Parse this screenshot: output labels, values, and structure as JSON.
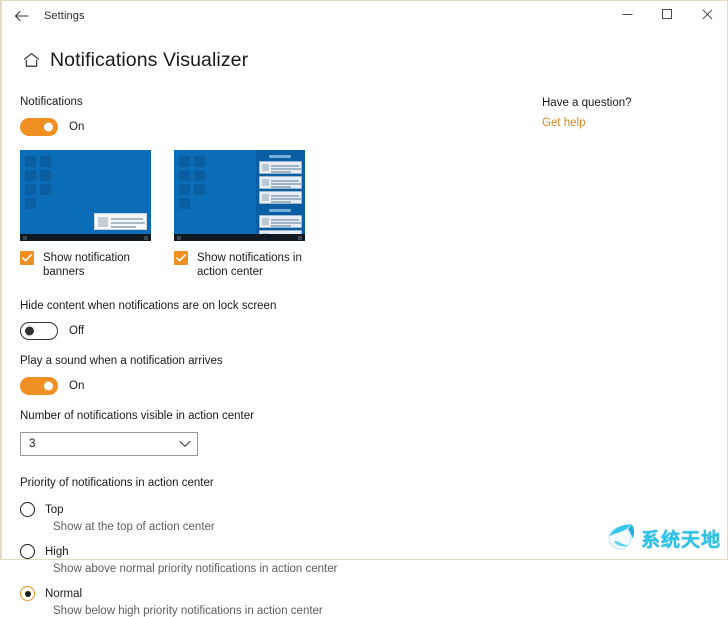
{
  "titlebar": {
    "back_label": "back-arrow",
    "app_title": "Settings",
    "minimize_label": "Minimize",
    "maximize_label": "Maximize",
    "close_label": "Close"
  },
  "header": {
    "home_icon": "home-icon",
    "page_title": "Notifications Visualizer"
  },
  "main": {
    "notifications_label": "Notifications",
    "notifications_toggle_state": "On",
    "previews": [
      {
        "name": "banner-preview",
        "checkbox_label": "Show notification banners",
        "checked": true
      },
      {
        "name": "action-center-preview",
        "checkbox_label": "Show notifications in action center",
        "checked": true
      }
    ],
    "hide_content_label": "Hide content when notifications are on lock screen",
    "hide_content_state": "Off",
    "play_sound_label": "Play a sound when a notification arrives",
    "play_sound_state": "On",
    "number_visible_label": "Number of notifications visible in action center",
    "number_visible_value": "3",
    "priority_label": "Priority of notifications in action center",
    "priority_options": [
      {
        "label": "Top",
        "description": "Show at the top of action center",
        "selected": false
      },
      {
        "label": "High",
        "description": "Show above normal priority notifications in action center",
        "selected": false
      },
      {
        "label": "Normal",
        "description": "Show below high priority notifications in action center",
        "selected": true
      }
    ]
  },
  "sidebar": {
    "question_title": "Have a question?",
    "help_link": "Get help"
  },
  "watermark": {
    "text": "系统天地",
    "icon": "globe-icon"
  },
  "colors": {
    "accent": "#f19022",
    "link": "#d98724",
    "preview_blue": "#0b6cb8",
    "watermark": "#2ec2e8"
  }
}
